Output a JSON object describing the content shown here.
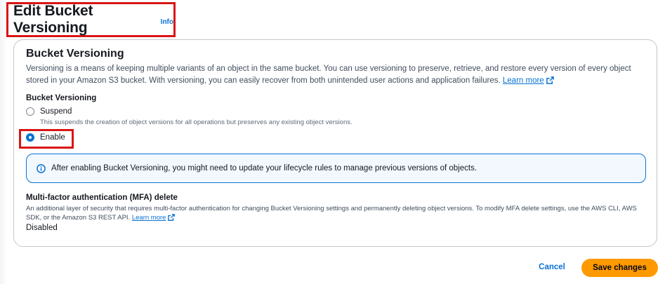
{
  "header": {
    "title": "Edit Bucket Versioning",
    "info_label": "Info"
  },
  "panel": {
    "title": "Bucket Versioning",
    "description": "Versioning is a means of keeping multiple variants of an object in the same bucket. You can use versioning to preserve, retrieve, and restore every version of every object stored in your Amazon S3 bucket. With versioning, you can easily recover from both unintended user actions and application failures.",
    "learn_more": "Learn more",
    "field_label": "Bucket Versioning",
    "options": [
      {
        "label": "Suspend",
        "description": "This suspends the creation of object versions for all operations but preserves any existing object versions.",
        "selected": false
      },
      {
        "label": "Enable",
        "selected": true
      }
    ],
    "alert": {
      "icon": "info-icon",
      "text": "After enabling Bucket Versioning, you might need to update your lifecycle rules to manage previous versions of objects."
    },
    "mfa": {
      "title": "Multi-factor authentication (MFA) delete",
      "description": "An additional layer of security that requires multi-factor authentication for changing Bucket Versioning settings and permanently deleting object versions. To modify MFA delete settings, use the AWS CLI, AWS SDK, or the Amazon S3 REST API.",
      "learn_more": "Learn more",
      "value": "Disabled"
    }
  },
  "actions": {
    "cancel": "Cancel",
    "save": "Save changes"
  },
  "colors": {
    "accent": "#0972d3",
    "primary_button": "#ff9900",
    "highlight": "#d91515"
  }
}
